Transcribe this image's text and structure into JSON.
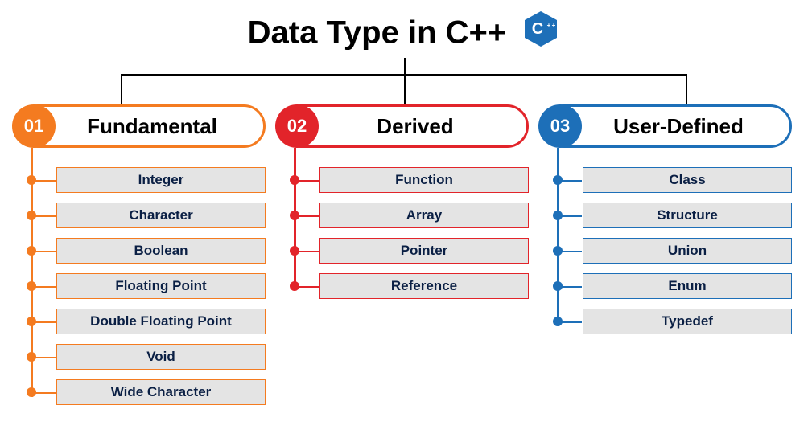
{
  "title": "Data Type in C++",
  "logo": {
    "letter": "C",
    "plus": "++",
    "color": "#1d6fb8"
  },
  "groups": [
    {
      "number": "01",
      "color": "orange",
      "label": "Fundamental",
      "items": [
        "Integer",
        "Character",
        "Boolean",
        "Floating Point",
        "Double Floating Point",
        "Void",
        "Wide Character"
      ]
    },
    {
      "number": "02",
      "color": "red",
      "label": "Derived",
      "items": [
        "Function",
        "Array",
        "Pointer",
        "Reference"
      ]
    },
    {
      "number": "03",
      "color": "blue",
      "label": "User-Defined",
      "items": [
        "Class",
        "Structure",
        "Union",
        "Enum",
        "Typedef"
      ]
    }
  ]
}
